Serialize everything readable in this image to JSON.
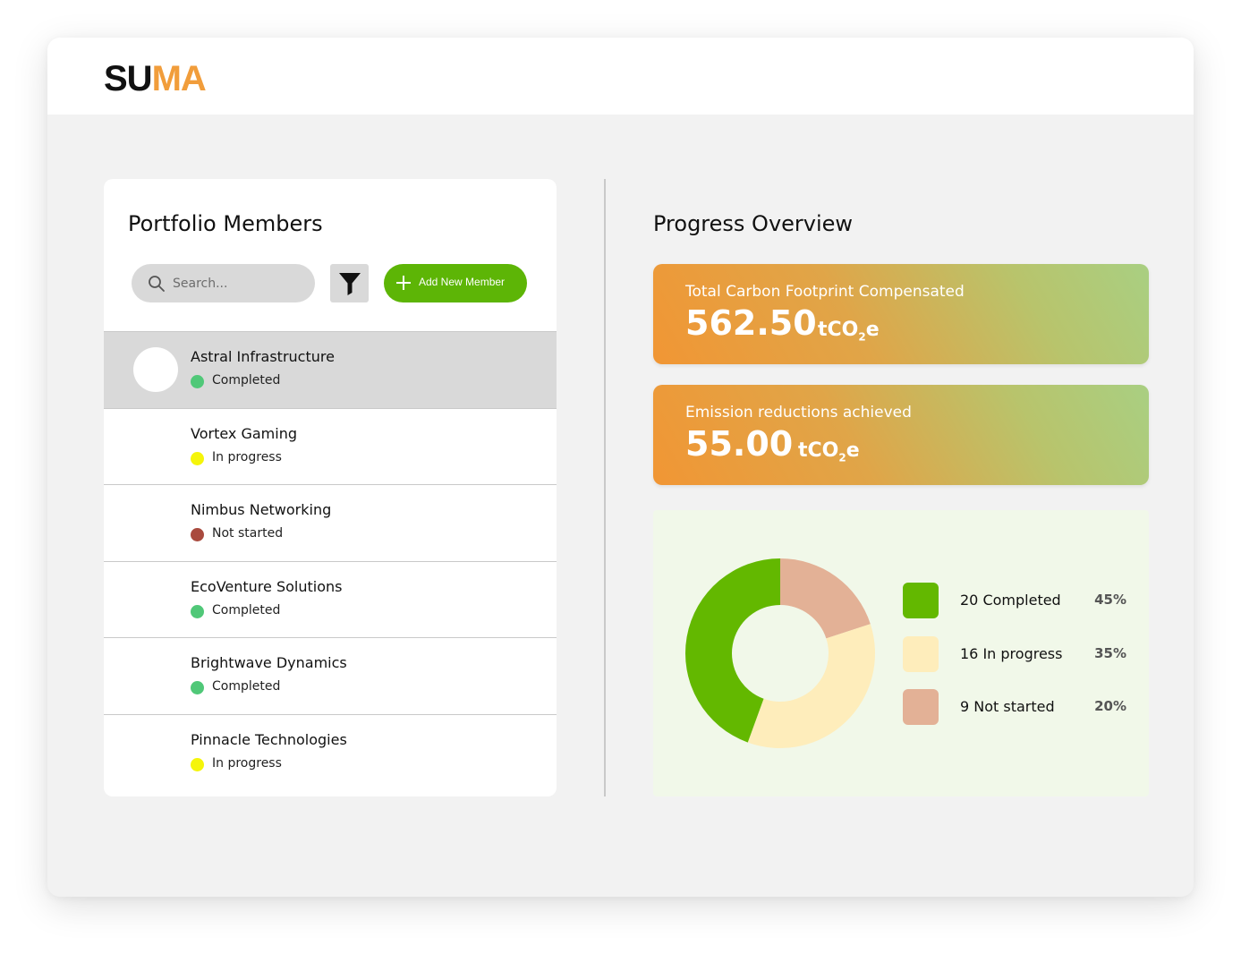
{
  "app": {
    "logo_part1": "SU",
    "logo_part2": "MA",
    "logo_color_primary": "#111111",
    "logo_color_accent": "#f19d3b"
  },
  "members_panel": {
    "title": "Portfolio Members",
    "search_placeholder": "Search...",
    "filter_icon": "filter-icon",
    "add_button_label": "Add New Member",
    "members": [
      {
        "name": "Astral Infrastructure",
        "status": "Completed",
        "status_color": "#50c878",
        "selected": true
      },
      {
        "name": "Vortex Gaming",
        "status": "In progress",
        "status_color": "#f5f50a",
        "selected": false
      },
      {
        "name": "Nimbus Networking",
        "status": "Not started",
        "status_color": "#a94a3e",
        "selected": false
      },
      {
        "name": "EcoVenture Solutions",
        "status": "Completed",
        "status_color": "#50c878",
        "selected": false
      },
      {
        "name": "Brightwave Dynamics",
        "status": "Completed",
        "status_color": "#50c878",
        "selected": false
      },
      {
        "name": "Pinnacle Technologies",
        "status": "In progress",
        "status_color": "#f5f50a",
        "selected": false
      }
    ]
  },
  "overview": {
    "title": "Progress Overview",
    "metrics": [
      {
        "label": "Total Carbon Footprint Compensated",
        "value": "562.50",
        "unit_prefix": "tCO",
        "unit_sub": "2",
        "unit_suffix": "e"
      },
      {
        "label": "Emission reductions achieved",
        "value": "55.00",
        "unit_prefix": "tCO",
        "unit_sub": "2",
        "unit_suffix": "e"
      }
    ]
  },
  "chart_data": {
    "type": "pie",
    "categories": [
      "Completed",
      "In progress",
      "Not started"
    ],
    "values": [
      20,
      16,
      9
    ],
    "legend_labels": [
      "20 Completed",
      "16 In progress",
      "9 Not started"
    ],
    "percent_labels": [
      "45%",
      "35%",
      "20%"
    ],
    "colors": [
      "#63b800",
      "#feedbb",
      "#e3b196"
    ],
    "legend": "right"
  }
}
